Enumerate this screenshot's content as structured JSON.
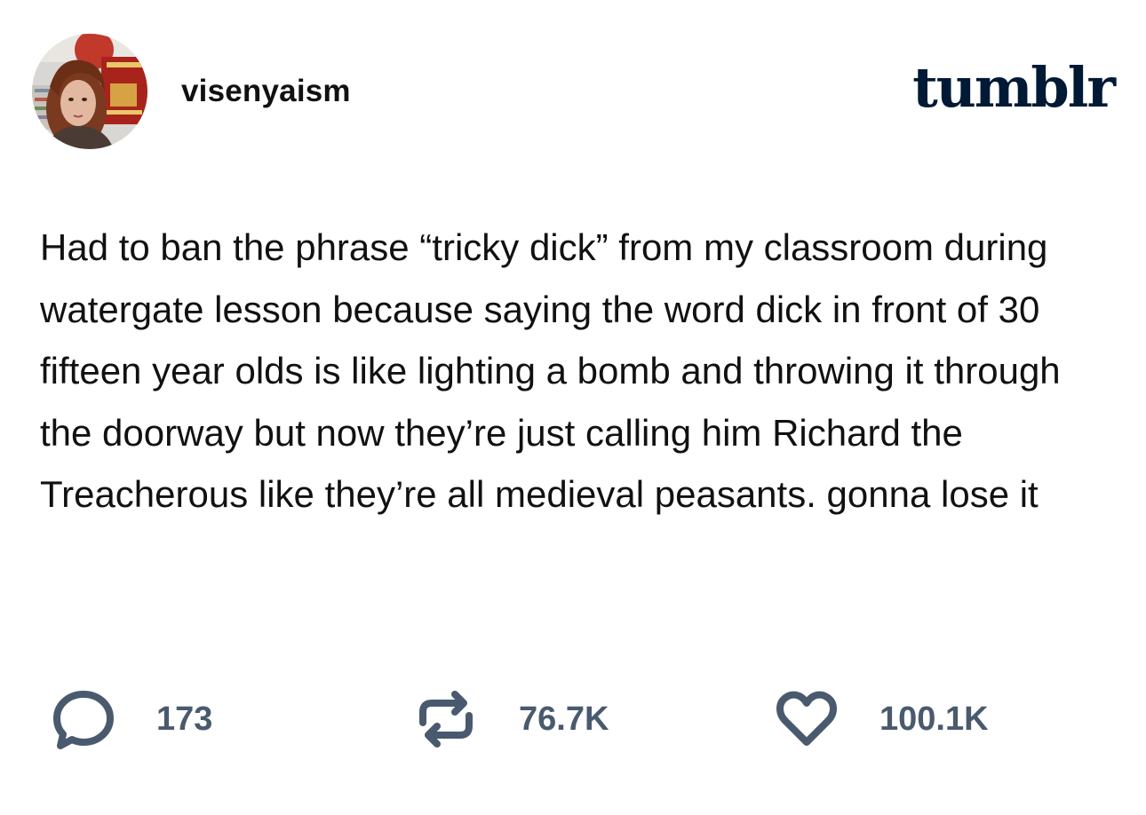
{
  "post": {
    "username": "visenyaism",
    "brand": "tumblr",
    "text": "Had to ban the phrase “tricky dick” from my classroom during watergate lesson because saying the word dick in front of 30 fifteen year olds is like lighting a bomb and throwing it through the doorway but now they’re just calling him Richard the Treacherous like they’re all medieval peasants. gonna lose it"
  },
  "stats": {
    "notes": "173",
    "reblogs": "76.7K",
    "likes": "100.1K"
  },
  "icons": {
    "notes": "speech-bubble-icon",
    "reblogs": "reblog-icon",
    "likes": "heart-icon"
  },
  "colors": {
    "brand": "#001935",
    "icon": "#4a5a6e",
    "text": "#111111",
    "background": "#ffffff"
  }
}
